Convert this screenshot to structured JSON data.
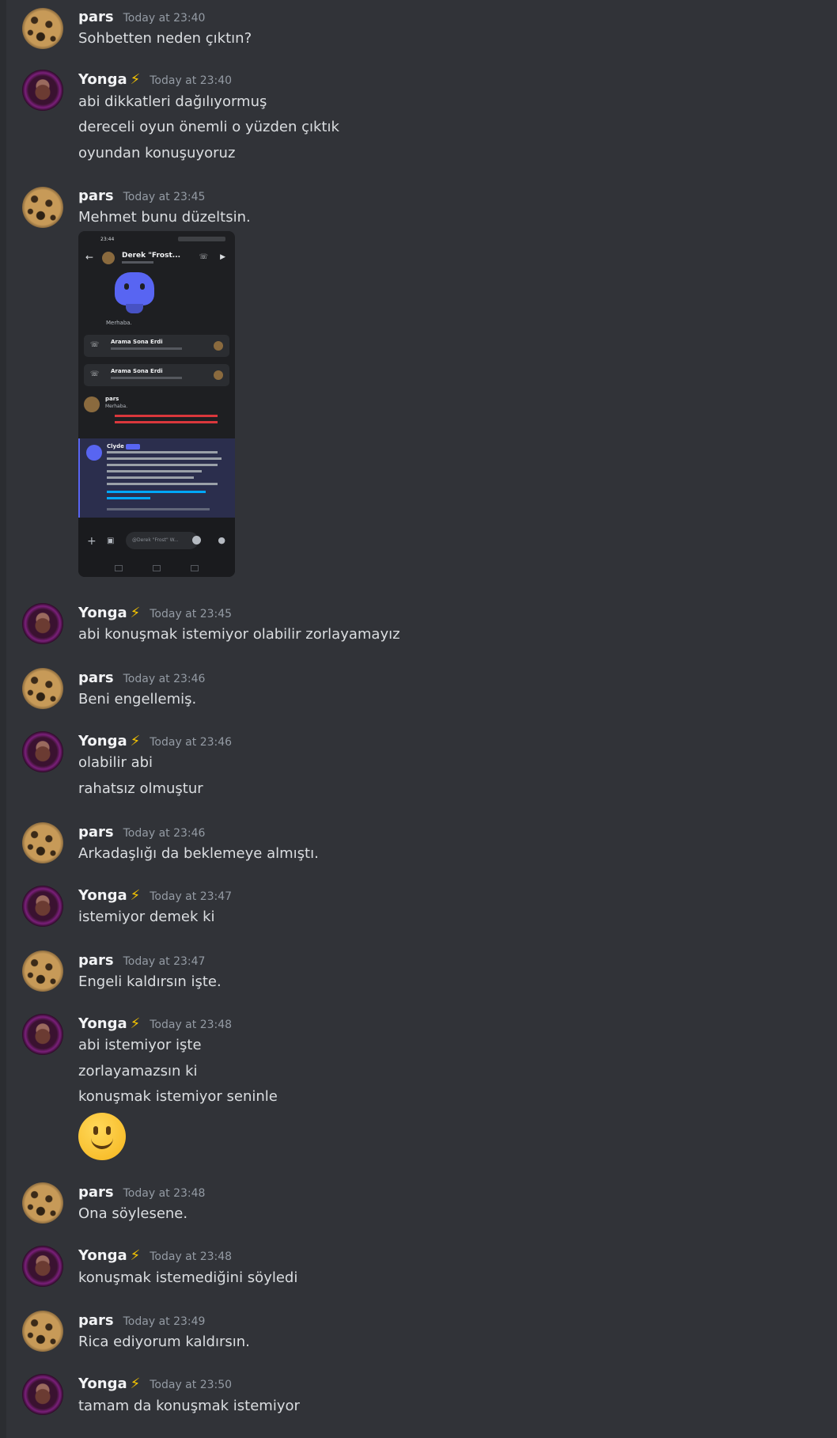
{
  "users": {
    "pars": {
      "name": "pars",
      "avatar": "leopard-avatar"
    },
    "yonga": {
      "name": "Yonga",
      "badge": "⚡",
      "avatar": "portrait-avatar"
    }
  },
  "messages": [
    {
      "user": "pars",
      "time": "Today at 23:40",
      "lines": [
        "Sohbetten neden çıktın?"
      ]
    },
    {
      "user": "Yonga",
      "time": "Today at 23:40",
      "lines": [
        "abi dikkatleri dağılıyormuş",
        "dereceli oyun önemli o yüzden çıktık",
        "oyundan konuşuyoruz"
      ]
    },
    {
      "user": "pars",
      "time": "Today at 23:45",
      "lines": [
        "Mehmet bunu düzeltsin."
      ]
    },
    {
      "user": "Yonga",
      "time": "Today at 23:45",
      "lines": [
        "abi konuşmak istemiyor olabilir zorlayamayız"
      ]
    },
    {
      "user": "pars",
      "time": "Today at 23:46",
      "lines": [
        "Beni engellemiş."
      ]
    },
    {
      "user": "Yonga",
      "time": "Today at 23:46",
      "lines": [
        "olabilir abi",
        "rahatsız olmuştur"
      ]
    },
    {
      "user": "pars",
      "time": "Today at 23:46",
      "lines": [
        "Arkadaşlığı da beklemeye almıştı."
      ]
    },
    {
      "user": "Yonga",
      "time": "Today at 23:47",
      "lines": [
        "istemiyor demek ki"
      ]
    },
    {
      "user": "pars",
      "time": "Today at 23:47",
      "lines": [
        "Engeli kaldırsın işte."
      ]
    },
    {
      "user": "Yonga",
      "time": "Today at 23:48",
      "lines": [
        "abi istemiyor işte",
        "zorlayamazsın ki",
        "konuşmak istemiyor seninle"
      ]
    },
    {
      "user": "pars",
      "time": "Today at 23:48",
      "lines": [
        "Ona söylesene."
      ]
    },
    {
      "user": "Yonga",
      "time": "Today at 23:48",
      "lines": [
        "konuşmak istemediğini söyledi"
      ]
    },
    {
      "user": "pars",
      "time": "Today at 23:49",
      "lines": [
        "Rica ediyorum kaldırsın."
      ]
    },
    {
      "user": "Yonga",
      "time": "Today at 23:50",
      "lines": [
        "tamam da konuşmak istemiyor"
      ]
    }
  ],
  "big_emoji": "slightly-smiling-face",
  "attachment": {
    "status_time": "23:44",
    "dm_title": "Derek \"Frost...",
    "greeting": "Merhaba.",
    "call_ended_1": "Arama Sona Erdi",
    "call_ended_2": "Arama Sona Erdi",
    "pars_name": "pars",
    "pars_msg": "Merhaba.",
    "clyde_name": "Clyde",
    "input_placeholder": "@Derek \"Frost\" W..."
  },
  "colors": {
    "background": "#313338",
    "username": "#f2f3f5",
    "timestamp": "#949ba4",
    "bolt": "#f5c400",
    "blurple": "#5865f2"
  }
}
